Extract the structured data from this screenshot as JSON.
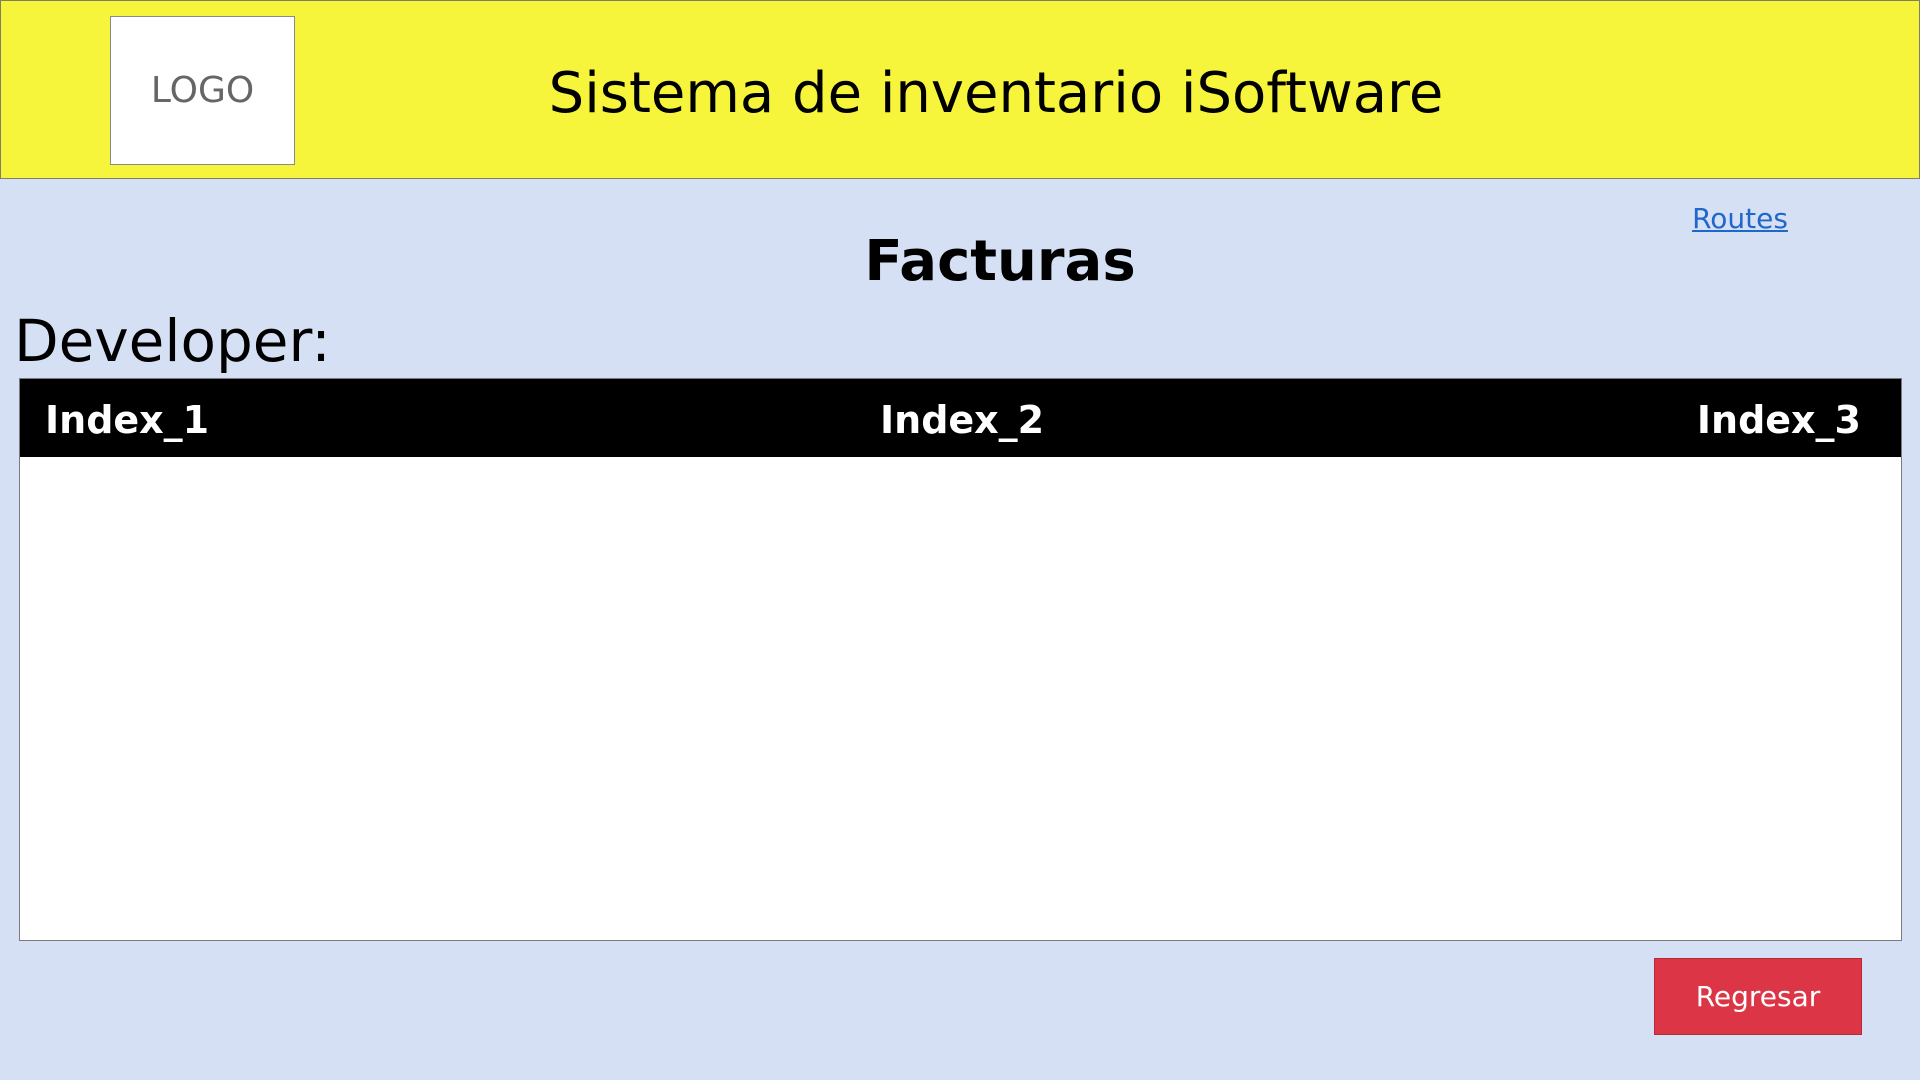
{
  "header": {
    "logo_text": "LOGO",
    "app_title": "Sistema de inventario iSoftware"
  },
  "nav": {
    "routes_label": "Routes"
  },
  "main": {
    "page_title": "Facturas",
    "developer_label": "Developer:",
    "table": {
      "columns": [
        "Index_1",
        "Index_2",
        "Index_3"
      ],
      "rows": []
    },
    "back_button_label": "Regresar"
  },
  "colors": {
    "header_bg": "#f7f43c",
    "page_bg": "#d6e0f4",
    "table_header_bg": "#000000",
    "link": "#1f67c9",
    "danger_button": "#dc3545"
  }
}
